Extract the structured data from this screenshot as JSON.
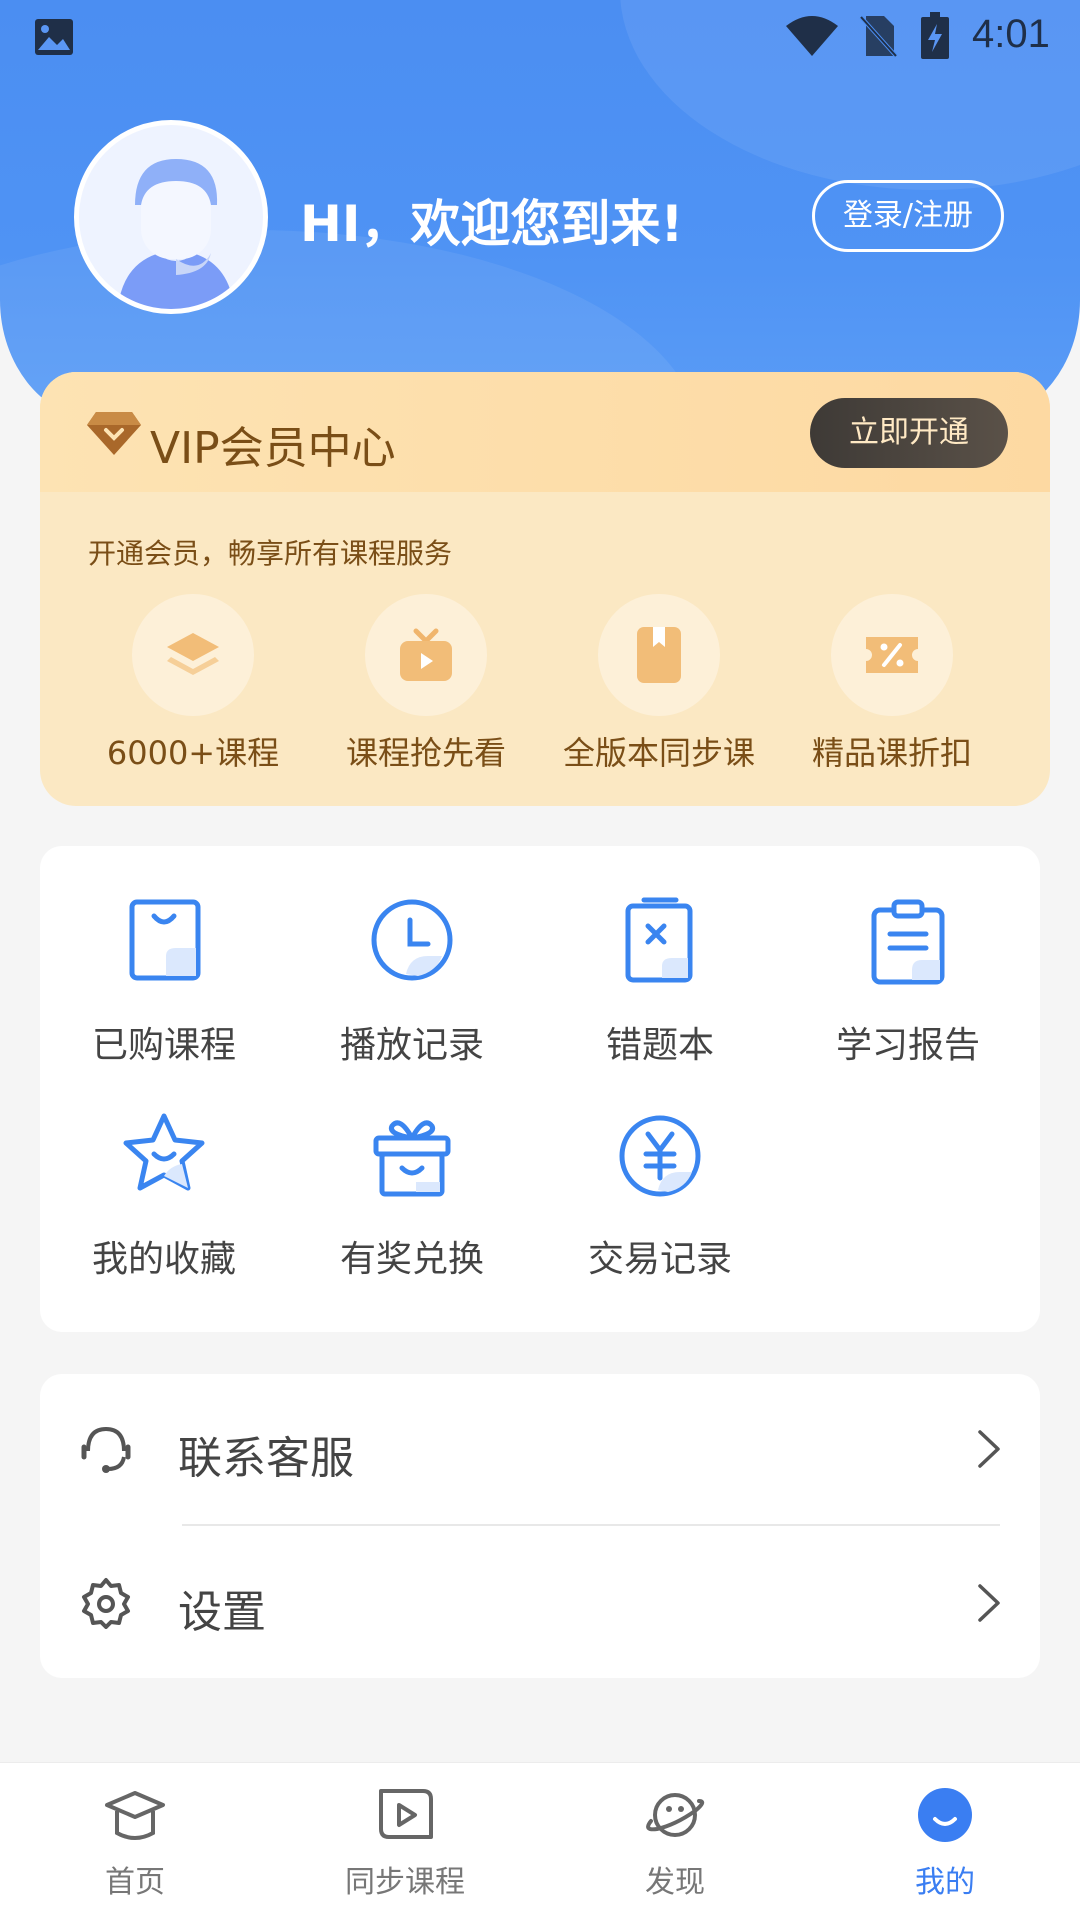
{
  "status_bar": {
    "time": "4:01"
  },
  "header": {
    "greeting": "HI，欢迎您到来!",
    "login_label": "登录/注册"
  },
  "vip": {
    "title": "VIP会员中心",
    "open_label": "立即开通",
    "subtitle": "开通会员，畅享所有课程服务",
    "items": [
      {
        "label": "6000+课程",
        "icon": "layers-icon"
      },
      {
        "label": "课程抢先看",
        "icon": "tv-play-icon"
      },
      {
        "label": "全版本同步课",
        "icon": "book-icon"
      },
      {
        "label": "精品课折扣",
        "icon": "discount-ticket-icon"
      }
    ]
  },
  "features": [
    {
      "label": "已购课程",
      "icon": "shopping-bag-icon"
    },
    {
      "label": "播放记录",
      "icon": "clock-icon"
    },
    {
      "label": "错题本",
      "icon": "wrong-notebook-icon"
    },
    {
      "label": "学习报告",
      "icon": "clipboard-icon"
    },
    {
      "label": "我的收藏",
      "icon": "star-icon"
    },
    {
      "label": "有奖兑换",
      "icon": "gift-icon"
    },
    {
      "label": "交易记录",
      "icon": "yuan-icon"
    }
  ],
  "menu": [
    {
      "label": "联系客服",
      "icon": "headset-icon"
    },
    {
      "label": "设置",
      "icon": "gear-icon"
    }
  ],
  "tabs": [
    {
      "label": "首页",
      "icon": "graduation-cap-icon"
    },
    {
      "label": "同步课程",
      "icon": "play-box-icon"
    },
    {
      "label": "发现",
      "icon": "planet-icon"
    },
    {
      "label": "我的",
      "icon": "profile-smile-icon",
      "active": true
    }
  ],
  "colors": {
    "primary": "#4b8ef2",
    "vip_text": "#7a4e17",
    "vip_bg": "#fbe8c3",
    "active_tab": "#3a7ef2"
  }
}
